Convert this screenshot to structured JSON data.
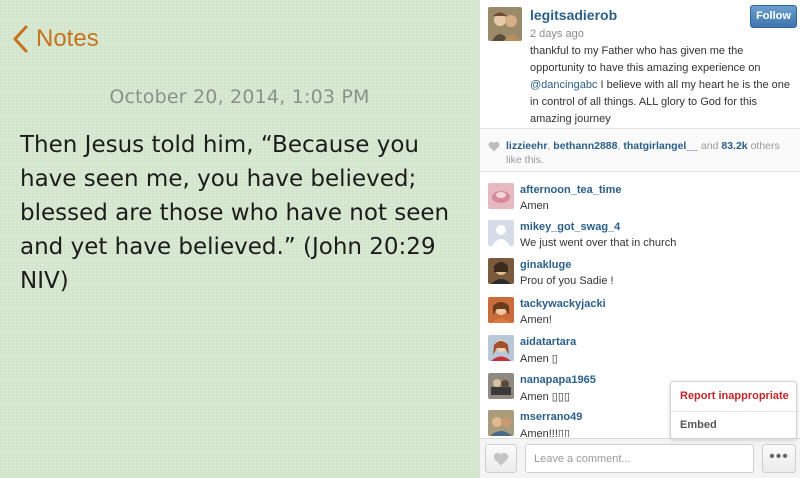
{
  "notes": {
    "back_label": "Notes",
    "date": "October 20, 2014, 1:03 PM",
    "body": "Then Jesus told him, “Because you have seen me, you have believed; blessed are those who have not seen and yet have believed.” (John 20:29 NIV)"
  },
  "post": {
    "username": "legitsadierob",
    "time": "2 days ago",
    "follow_label": "Follow",
    "caption_before": "thankful to my Father who has given me the opportunity to have this amazing experience on ",
    "caption_mention": "@dancingabc",
    "caption_after": " I believe with all my heart he is the one in control of all things. ALL glory to God for this amazing journey"
  },
  "likes": {
    "liker1": "lizzieehr",
    "sep1": ", ",
    "liker2": "bethann2888",
    "sep2": ", ",
    "liker3": "thatgirlangel__",
    "and_text": " and ",
    "count": "83.2k",
    "suffix": " others like this."
  },
  "comments": [
    {
      "user": "afternoon_tea_time",
      "text": "Amen"
    },
    {
      "user": "mikey_got_swag_4",
      "text": "We just went over that in church"
    },
    {
      "user": "ginakluge",
      "text": "Prou of you Sadie !"
    },
    {
      "user": "tackywackyjacki",
      "text": "Amen!"
    },
    {
      "user": "aidatartara",
      "text": "Amen ▯"
    },
    {
      "user": "nanapapa1965",
      "text": "Amen    ▯▯▯"
    },
    {
      "user": "mserrano49",
      "text": "Amen!!!▯▯"
    }
  ],
  "menu": {
    "report": "Report inappropriate",
    "embed": "Embed"
  },
  "footer": {
    "placeholder": "Leave a comment...",
    "more": "•••"
  },
  "colors": {
    "notes_accent": "#c7731d",
    "link_blue": "#2b5f8a",
    "report_red": "#c0262b",
    "notes_paper": "#d6e7cf"
  }
}
